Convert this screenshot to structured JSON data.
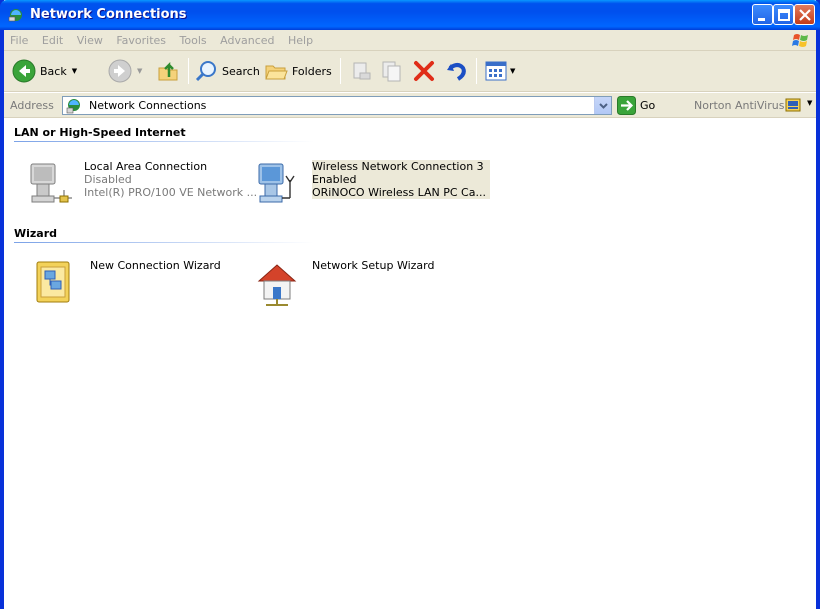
{
  "window": {
    "title": "Network Connections"
  },
  "menu": {
    "items": [
      "File",
      "Edit",
      "View",
      "Favorites",
      "Tools",
      "Advanced",
      "Help"
    ]
  },
  "toolbar": {
    "back_label": "Back",
    "search_label": "Search",
    "folders_label": "Folders"
  },
  "address": {
    "label": "Address",
    "value": "Network Connections",
    "go_label": "Go",
    "norton_label": "Norton AntiVirus"
  },
  "groups": [
    {
      "header": "LAN or High-Speed Internet",
      "items": [
        {
          "name": "Local Area Connection",
          "status": "Disabled",
          "device": "Intel(R) PRO/100 VE Network ..."
        },
        {
          "name": "Wireless Network Connection 3",
          "status": "Enabled",
          "device": "ORiNOCO Wireless LAN PC Ca..."
        }
      ]
    },
    {
      "header": "Wizard",
      "items": [
        {
          "name": "New Connection Wizard"
        },
        {
          "name": "Network Setup Wizard"
        }
      ]
    }
  ],
  "colors": {
    "titlebar": "#0054e3",
    "toolbar_bg": "#ece9d8",
    "group_line": "#7ba2e7",
    "selection_bg": "#ece9d8"
  }
}
